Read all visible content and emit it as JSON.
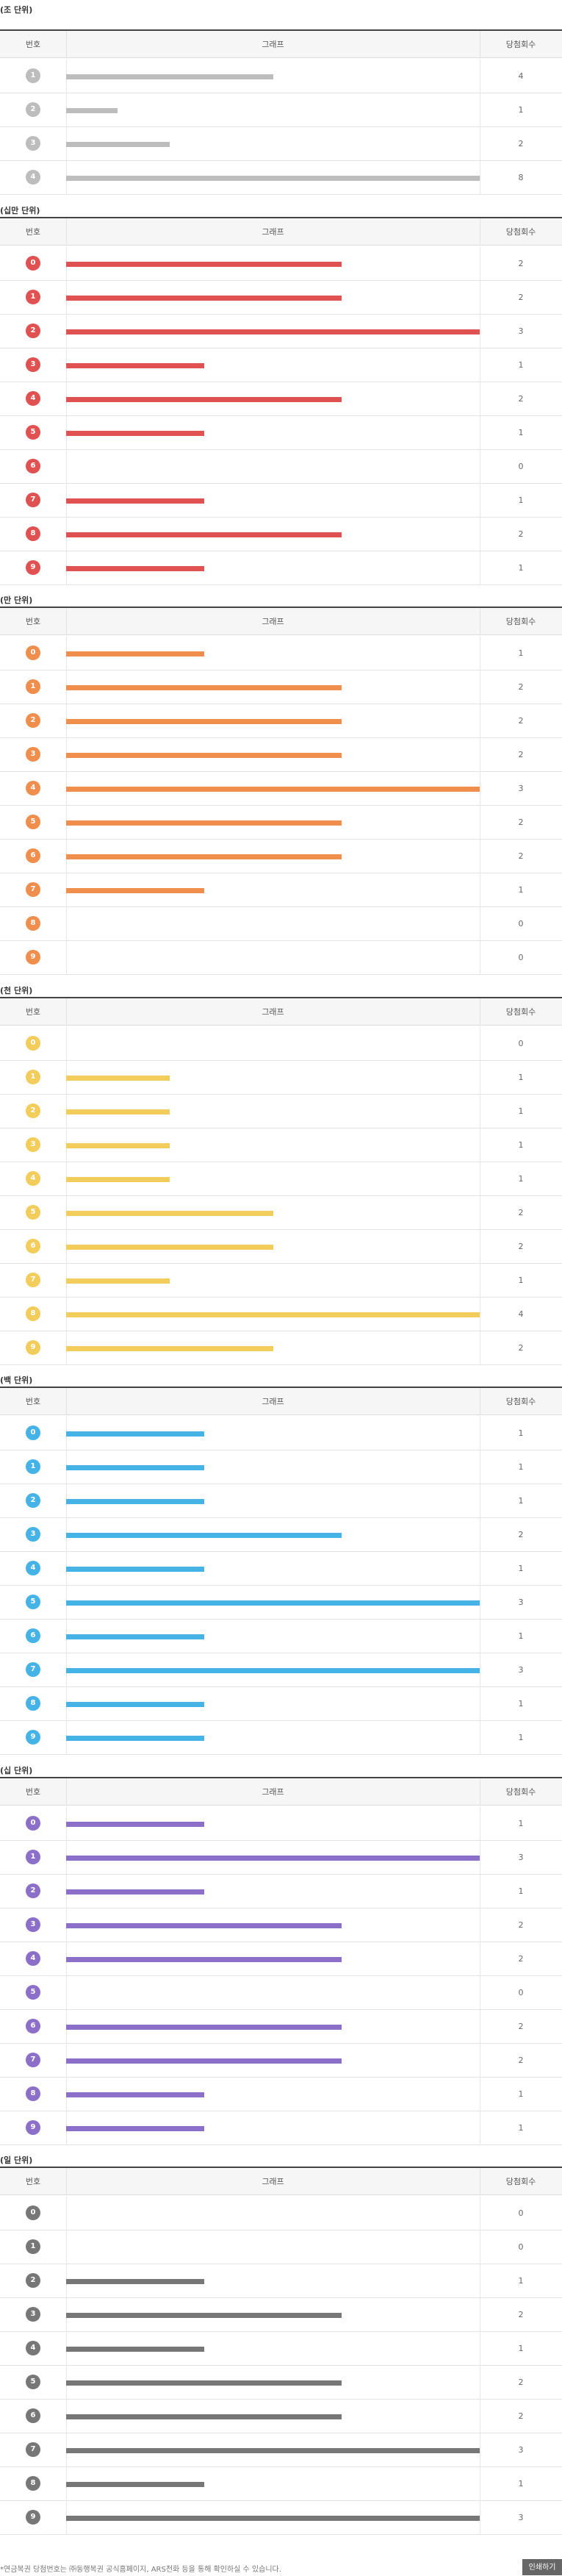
{
  "sections": [
    {
      "title": "(조 단위)",
      "headers": {
        "num": "번호",
        "graph": "그래프",
        "count": "당첨회수"
      },
      "color": "#bdbdbd",
      "chart_data": {
        "type": "bar",
        "categories": [
          "1",
          "2",
          "3",
          "4"
        ],
        "values": [
          4,
          1,
          2,
          8
        ],
        "xlim": [
          0,
          8
        ]
      }
    },
    {
      "title": "(십만 단위)",
      "headers": {
        "num": "번호",
        "graph": "그래프",
        "count": "당첨회수"
      },
      "color": "#e05151",
      "chart_data": {
        "type": "bar",
        "categories": [
          "0",
          "1",
          "2",
          "3",
          "4",
          "5",
          "6",
          "7",
          "8",
          "9"
        ],
        "values": [
          2,
          2,
          3,
          1,
          2,
          1,
          0,
          1,
          2,
          1
        ],
        "xlim": [
          0,
          3
        ]
      }
    },
    {
      "title": "(만 단위)",
      "headers": {
        "num": "번호",
        "graph": "그래프",
        "count": "당첨회수"
      },
      "color": "#f08e4e",
      "chart_data": {
        "type": "bar",
        "categories": [
          "0",
          "1",
          "2",
          "3",
          "4",
          "5",
          "6",
          "7",
          "8",
          "9"
        ],
        "values": [
          1,
          2,
          2,
          2,
          3,
          2,
          2,
          1,
          0,
          0
        ],
        "xlim": [
          0,
          3
        ]
      }
    },
    {
      "title": "(천 단위)",
      "headers": {
        "num": "번호",
        "graph": "그래프",
        "count": "당첨회수"
      },
      "color": "#f3cd5c",
      "chart_data": {
        "type": "bar",
        "categories": [
          "0",
          "1",
          "2",
          "3",
          "4",
          "5",
          "6",
          "7",
          "8",
          "9"
        ],
        "values": [
          0,
          1,
          1,
          1,
          1,
          2,
          2,
          1,
          4,
          2
        ],
        "xlim": [
          0,
          4
        ]
      }
    },
    {
      "title": "(백 단위)",
      "headers": {
        "num": "번호",
        "graph": "그래프",
        "count": "당첨회수"
      },
      "color": "#45b3e6",
      "chart_data": {
        "type": "bar",
        "categories": [
          "0",
          "1",
          "2",
          "3",
          "4",
          "5",
          "6",
          "7",
          "8",
          "9"
        ],
        "values": [
          1,
          1,
          1,
          2,
          1,
          3,
          1,
          3,
          1,
          1
        ],
        "xlim": [
          0,
          3
        ]
      }
    },
    {
      "title": "(십 단위)",
      "headers": {
        "num": "번호",
        "graph": "그래프",
        "count": "당첨회수"
      },
      "color": "#8c6fc9",
      "chart_data": {
        "type": "bar",
        "categories": [
          "0",
          "1",
          "2",
          "3",
          "4",
          "5",
          "6",
          "7",
          "8",
          "9"
        ],
        "values": [
          1,
          3,
          1,
          2,
          2,
          0,
          2,
          2,
          1,
          1
        ],
        "xlim": [
          0,
          3
        ]
      }
    },
    {
      "title": "(일 단위)",
      "headers": {
        "num": "번호",
        "graph": "그래프",
        "count": "당첨회수"
      },
      "color": "#777777",
      "chart_data": {
        "type": "bar",
        "categories": [
          "0",
          "1",
          "2",
          "3",
          "4",
          "5",
          "6",
          "7",
          "8",
          "9"
        ],
        "values": [
          0,
          0,
          1,
          2,
          1,
          2,
          2,
          3,
          1,
          3
        ],
        "xlim": [
          0,
          3
        ]
      }
    }
  ],
  "footer": {
    "note": "*연금복권 당첨번호는 ㈜동행복권 공식홈페이지, ARS전화 등을 통해 확인하실 수 있습니다.",
    "print_label": "인쇄하기"
  }
}
